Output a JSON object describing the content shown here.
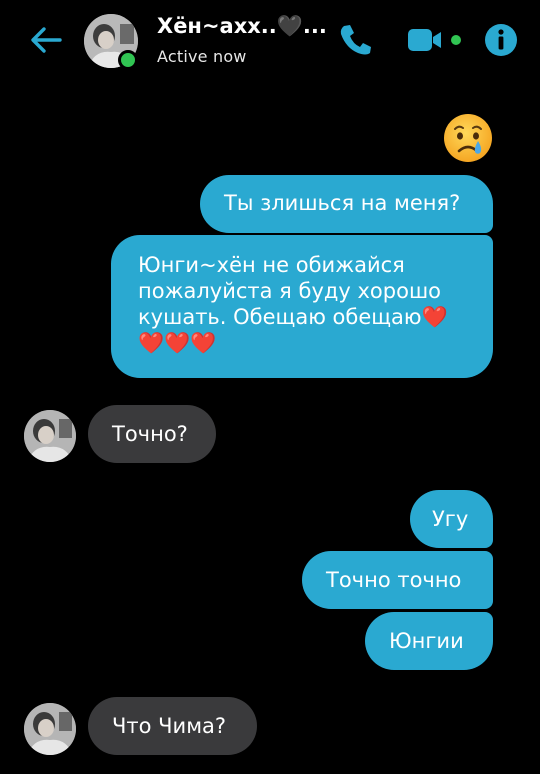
{
  "header": {
    "contact_name": "Хён~ахх..🖤...",
    "status": "Active now",
    "icons": {
      "back": "back-arrow-icon",
      "call": "phone-icon",
      "video": "video-camera-icon",
      "info": "info-icon"
    }
  },
  "colors": {
    "accent": "#2aa9d1",
    "incoming_bubble": "#3a3a3c",
    "online": "#31c553",
    "background": "#000000"
  },
  "messages": [
    {
      "direction": "out",
      "type": "emoji",
      "text": "😢"
    },
    {
      "direction": "out",
      "text": "Ты злишься на меня?"
    },
    {
      "direction": "out",
      "text": "Юнги~хён не обижайся пожалуйста я буду хорошо кушать. Обещаю обещаю❤️❤️❤️❤️"
    },
    {
      "direction": "in",
      "text": "Точно?"
    },
    {
      "direction": "out",
      "text": "Угу"
    },
    {
      "direction": "out",
      "text": "Точно точно"
    },
    {
      "direction": "out",
      "text": "Юнгии"
    },
    {
      "direction": "in",
      "text": "Что Чима?"
    }
  ]
}
